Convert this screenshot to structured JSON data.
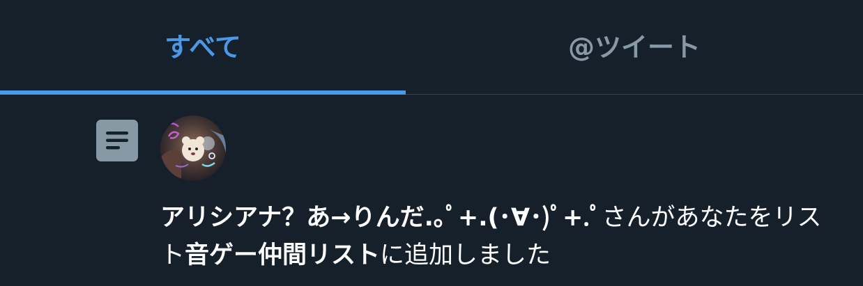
{
  "tabs": {
    "all_label": "すべて",
    "mentions_label": "@ツイート",
    "active": "all",
    "active_color": "#4a99e9",
    "inactive_color": "#8899a6"
  },
  "notification": {
    "icon": "list-icon",
    "avatar_alt": "avatar",
    "user_name": "アリシアナ？あ→りんだ.｡ﾟ+.(･∀･)ﾟ+.ﾟ",
    "text_before_list": "さんがあなたをリスト",
    "list_name": "音ゲー仲間リスト",
    "text_after_list": "に追加しました"
  },
  "colors": {
    "background": "#15202b",
    "divider": "#38444d",
    "icon_bg": "#8899a6"
  }
}
